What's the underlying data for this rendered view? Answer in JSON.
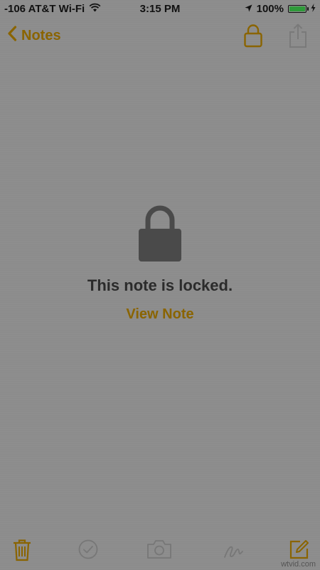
{
  "status_bar": {
    "carrier": "-106 AT&T Wi-Fi",
    "time": "3:15 PM",
    "battery_text": "100%",
    "battery_level": 1.0,
    "battery_color": "#2f9a3a"
  },
  "nav": {
    "back_label": "Notes",
    "accent_color": "#8a6400",
    "lock_icon": "lock-icon",
    "share_icon": "share-icon"
  },
  "content": {
    "locked_message": "This note is locked.",
    "view_note_label": "View Note"
  },
  "toolbar": {
    "icons": [
      "trash-icon",
      "checklist-icon",
      "camera-icon",
      "sketch-icon",
      "compose-icon"
    ]
  },
  "watermark": "wtvid.com"
}
